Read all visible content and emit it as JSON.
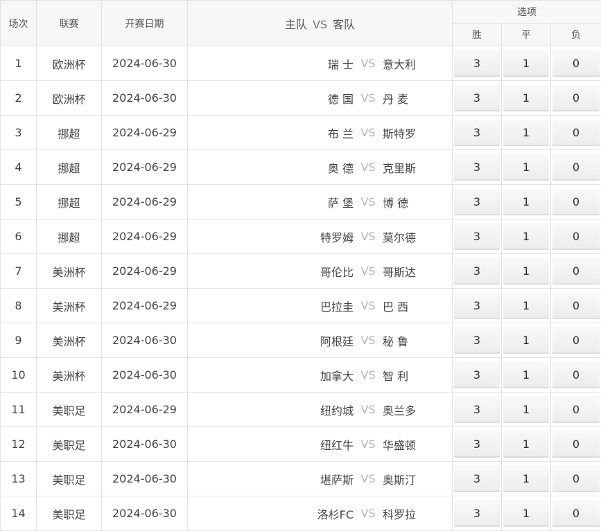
{
  "header": {
    "col_index": "场次",
    "col_league": "联赛",
    "col_date": "开赛日期",
    "col_home": "主队",
    "col_vs": "VS",
    "col_away": "客队",
    "col_options": "选项",
    "opt_win": "胜",
    "opt_draw": "平",
    "opt_lose": "负"
  },
  "rows": [
    {
      "no": "1",
      "league": "欧洲杯",
      "date": "2024-06-30",
      "home": "瑞 士",
      "vs": "VS",
      "away": "意大利",
      "win": "3",
      "draw": "1",
      "lose": "0"
    },
    {
      "no": "2",
      "league": "欧洲杯",
      "date": "2024-06-30",
      "home": "德 国",
      "vs": "VS",
      "away": "丹 麦",
      "win": "3",
      "draw": "1",
      "lose": "0"
    },
    {
      "no": "3",
      "league": "挪超",
      "date": "2024-06-29",
      "home": "布 兰",
      "vs": "VS",
      "away": "斯特罗",
      "win": "3",
      "draw": "1",
      "lose": "0"
    },
    {
      "no": "4",
      "league": "挪超",
      "date": "2024-06-29",
      "home": "奥 德",
      "vs": "VS",
      "away": "克里斯",
      "win": "3",
      "draw": "1",
      "lose": "0"
    },
    {
      "no": "5",
      "league": "挪超",
      "date": "2024-06-29",
      "home": "萨 堡",
      "vs": "VS",
      "away": "博 德",
      "win": "3",
      "draw": "1",
      "lose": "0"
    },
    {
      "no": "6",
      "league": "挪超",
      "date": "2024-06-29",
      "home": "特罗姆",
      "vs": "VS",
      "away": "莫尔德",
      "win": "3",
      "draw": "1",
      "lose": "0"
    },
    {
      "no": "7",
      "league": "美洲杯",
      "date": "2024-06-29",
      "home": "哥伦比",
      "vs": "VS",
      "away": "哥斯达",
      "win": "3",
      "draw": "1",
      "lose": "0"
    },
    {
      "no": "8",
      "league": "美洲杯",
      "date": "2024-06-29",
      "home": "巴拉圭",
      "vs": "VS",
      "away": "巴 西",
      "win": "3",
      "draw": "1",
      "lose": "0"
    },
    {
      "no": "9",
      "league": "美洲杯",
      "date": "2024-06-30",
      "home": "阿根廷",
      "vs": "VS",
      "away": "秘 鲁",
      "win": "3",
      "draw": "1",
      "lose": "0"
    },
    {
      "no": "10",
      "league": "美洲杯",
      "date": "2024-06-30",
      "home": "加拿大",
      "vs": "VS",
      "away": "智 利",
      "win": "3",
      "draw": "1",
      "lose": "0"
    },
    {
      "no": "11",
      "league": "美职足",
      "date": "2024-06-29",
      "home": "纽约城",
      "vs": "VS",
      "away": "奥兰多",
      "win": "3",
      "draw": "1",
      "lose": "0"
    },
    {
      "no": "12",
      "league": "美职足",
      "date": "2024-06-30",
      "home": "纽红牛",
      "vs": "VS",
      "away": "华盛顿",
      "win": "3",
      "draw": "1",
      "lose": "0"
    },
    {
      "no": "13",
      "league": "美职足",
      "date": "2024-06-30",
      "home": "堪萨斯",
      "vs": "VS",
      "away": "奥斯汀",
      "win": "3",
      "draw": "1",
      "lose": "0"
    },
    {
      "no": "14",
      "league": "美职足",
      "date": "2024-06-30",
      "home": "洛杉FC",
      "vs": "VS",
      "away": "科罗拉",
      "win": "3",
      "draw": "1",
      "lose": "0"
    }
  ]
}
